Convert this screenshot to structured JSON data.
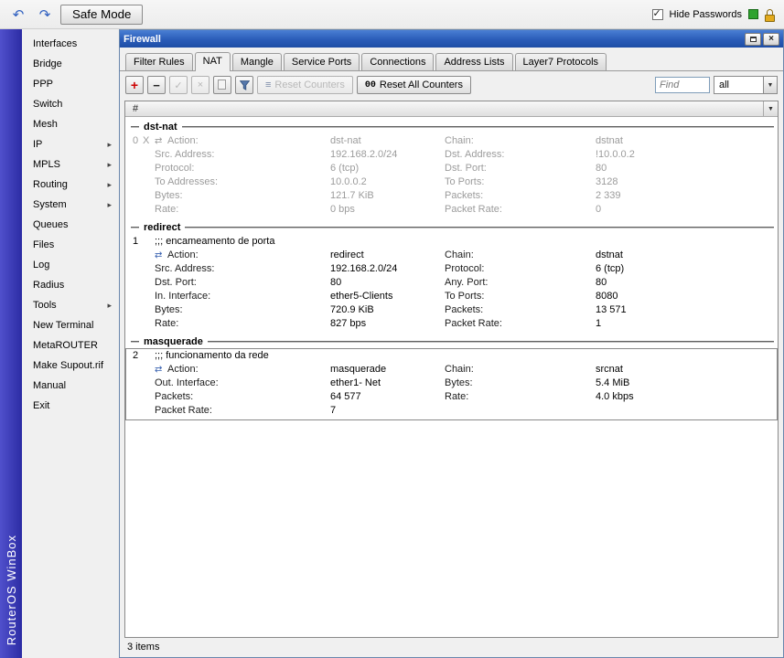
{
  "topbar": {
    "safe_mode": "Safe Mode",
    "hide_passwords": "Hide Passwords"
  },
  "brand": {
    "vertical_text": "RouterOS WinBox"
  },
  "icons": {
    "undo": "↶",
    "redo": "↷",
    "checkbox_check": "✓",
    "submenu_arrow": "▸",
    "dropdown_arrow": "▼",
    "add": "+",
    "remove": "−",
    "enable": "✓",
    "disable": "×",
    "reset_lines": "≡",
    "action_arrows": "⇄",
    "close": "×"
  },
  "sidebar": {
    "items": [
      {
        "label": "Interfaces",
        "submenu": false
      },
      {
        "label": "Bridge",
        "submenu": false
      },
      {
        "label": "PPP",
        "submenu": false
      },
      {
        "label": "Switch",
        "submenu": false
      },
      {
        "label": "Mesh",
        "submenu": false
      },
      {
        "label": "IP",
        "submenu": true
      },
      {
        "label": "MPLS",
        "submenu": true
      },
      {
        "label": "Routing",
        "submenu": true
      },
      {
        "label": "System",
        "submenu": true
      },
      {
        "label": "Queues",
        "submenu": false
      },
      {
        "label": "Files",
        "submenu": false
      },
      {
        "label": "Log",
        "submenu": false
      },
      {
        "label": "Radius",
        "submenu": false
      },
      {
        "label": "Tools",
        "submenu": true
      },
      {
        "label": "New Terminal",
        "submenu": false
      },
      {
        "label": "MetaROUTER",
        "submenu": false
      },
      {
        "label": "Make Supout.rif",
        "submenu": false
      },
      {
        "label": "Manual",
        "submenu": false
      },
      {
        "label": "Exit",
        "submenu": false
      }
    ]
  },
  "window": {
    "title": "Firewall",
    "tabs": [
      "Filter Rules",
      "NAT",
      "Mangle",
      "Service Ports",
      "Connections",
      "Address Lists",
      "Layer7 Protocols"
    ],
    "active_tab": "NAT",
    "toolbar": {
      "reset_counters": "Reset Counters",
      "reset_all_prefix": "00",
      "reset_all_counters": "Reset All Counters",
      "find_placeholder": "Find",
      "filter_selected": "all"
    },
    "columns_hash": "#",
    "status": "3 items"
  },
  "nat_groups": [
    {
      "name": "dst-nat",
      "rules": [
        {
          "num": "0",
          "flag": "X",
          "disabled": true,
          "selected": false,
          "comment": "",
          "fields": [
            {
              "l1": "Action:",
              "v1": "dst-nat",
              "l2": "Chain:",
              "v2": "dstnat"
            },
            {
              "l1": "Src. Address:",
              "v1": "192.168.2.0/24",
              "l2": "Dst. Address:",
              "v2": "!10.0.0.2"
            },
            {
              "l1": "Protocol:",
              "v1": "6 (tcp)",
              "l2": "Dst. Port:",
              "v2": "80"
            },
            {
              "l1": "To Addresses:",
              "v1": "10.0.0.2",
              "l2": "To Ports:",
              "v2": "3128"
            },
            {
              "l1": "Bytes:",
              "v1": "121.7 KiB",
              "l2": "Packets:",
              "v2": "2 339"
            },
            {
              "l1": "Rate:",
              "v1": "0 bps",
              "l2": "Packet Rate:",
              "v2": "0"
            }
          ]
        }
      ]
    },
    {
      "name": "redirect",
      "rules": [
        {
          "num": "1",
          "flag": "",
          "disabled": false,
          "selected": false,
          "comment": ";;; encameamento de porta",
          "fields": [
            {
              "l1": "Action:",
              "v1": "redirect",
              "l2": "Chain:",
              "v2": "dstnat"
            },
            {
              "l1": "Src. Address:",
              "v1": "192.168.2.0/24",
              "l2": "Protocol:",
              "v2": "6 (tcp)"
            },
            {
              "l1": "Dst. Port:",
              "v1": "80",
              "l2": "Any. Port:",
              "v2": "80"
            },
            {
              "l1": "In. Interface:",
              "v1": "ether5-Clients",
              "l2": "To Ports:",
              "v2": "8080"
            },
            {
              "l1": "Bytes:",
              "v1": "720.9 KiB",
              "l2": "Packets:",
              "v2": "13 571"
            },
            {
              "l1": "Rate:",
              "v1": "827 bps",
              "l2": "Packet Rate:",
              "v2": "1"
            }
          ]
        }
      ]
    },
    {
      "name": "masquerade",
      "rules": [
        {
          "num": "2",
          "flag": "",
          "disabled": false,
          "selected": true,
          "comment": ";;; funcionamento da rede",
          "fields": [
            {
              "l1": "Action:",
              "v1": "masquerade",
              "l2": "Chain:",
              "v2": "srcnat"
            },
            {
              "l1": "Out. Interface:",
              "v1": "ether1- Net",
              "l2": "Bytes:",
              "v2": "5.4 MiB"
            },
            {
              "l1": "Packets:",
              "v1": "64 577",
              "l2": "Rate:",
              "v2": "4.0 kbps"
            },
            {
              "l1": "Packet Rate:",
              "v1": "7",
              "l2": "",
              "v2": ""
            }
          ]
        }
      ]
    }
  ],
  "colors": {
    "titlebar_blue": "#2a5cb8",
    "brand_blue": "#3a3ab8",
    "accent_red": "#cc0000",
    "disabled_text": "#9c9c9c",
    "status_green": "#2fa32f",
    "lock_gold": "#e3aa1c"
  }
}
